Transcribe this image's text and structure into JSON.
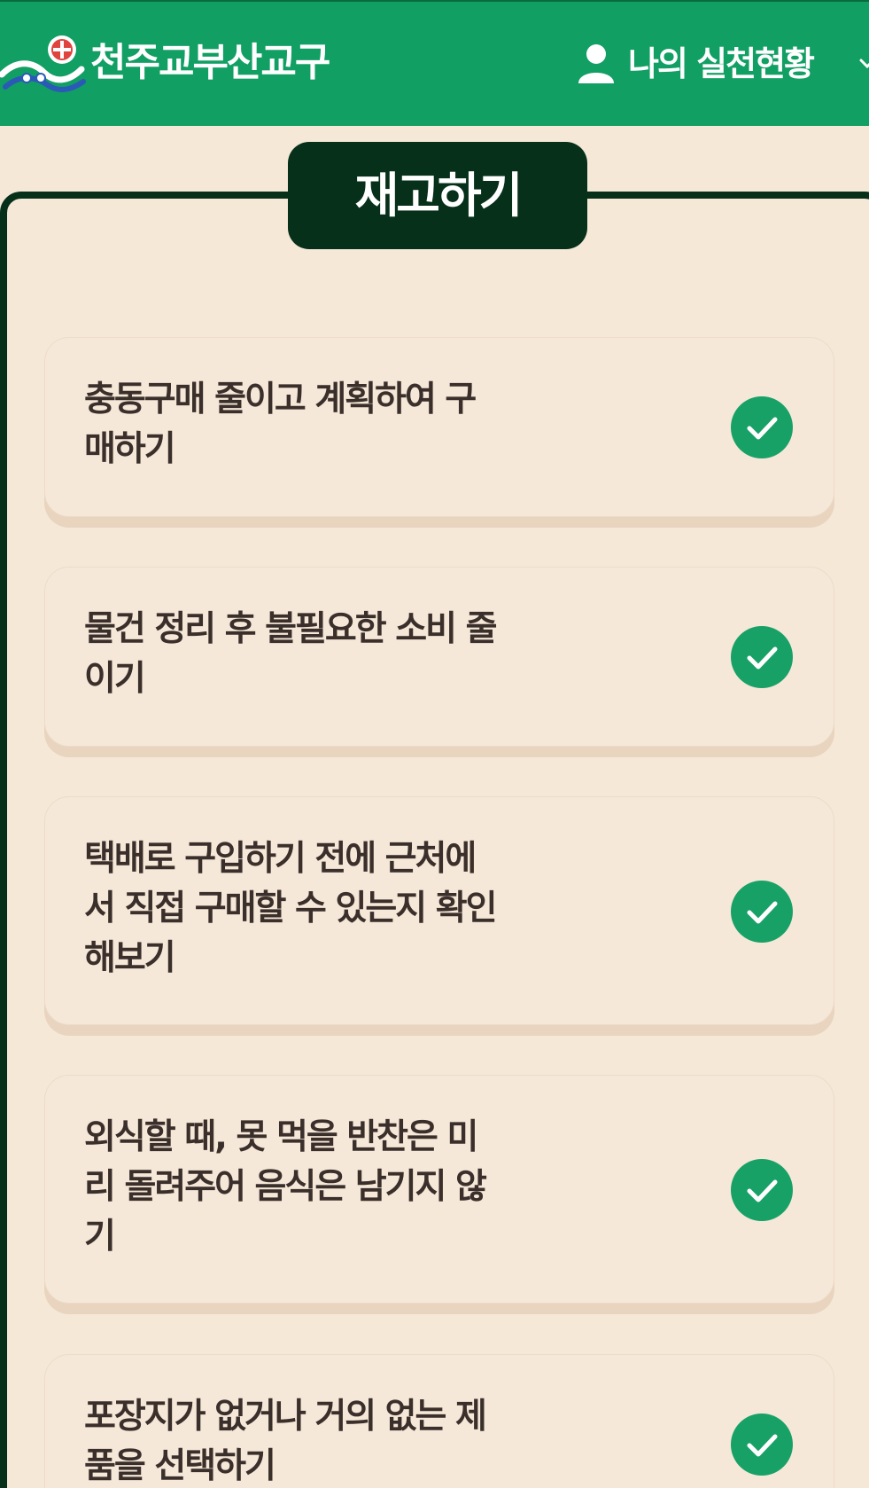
{
  "header": {
    "brand": "천주교부산교구",
    "user_label": "나의 실천현황",
    "icons": {
      "logo": "diocese-logo",
      "user": "user-icon",
      "dropdown": "chevron-down-icon"
    }
  },
  "section": {
    "title": "재고하기"
  },
  "items": [
    {
      "label": "충동구매 줄이고 계획하여 구매하기",
      "checked": true
    },
    {
      "label": "물건 정리 후 불필요한 소비 줄이기",
      "checked": true
    },
    {
      "label": "택배로 구입하기 전에 근처에서 직접 구매할 수 있는지 확인해보기",
      "checked": true
    },
    {
      "label": "외식할 때, 못 먹을 반찬은 미리 돌려주어 음식은 남기지 않기",
      "checked": true
    },
    {
      "label": "포장지가 없거나 거의 없는 제품을 선택하기",
      "checked": true
    }
  ],
  "colors": {
    "header_bg": "#119f63",
    "page_bg": "#f5e8d7",
    "frame": "#063019",
    "check": "#18a166",
    "text": "#3a2f2b"
  }
}
